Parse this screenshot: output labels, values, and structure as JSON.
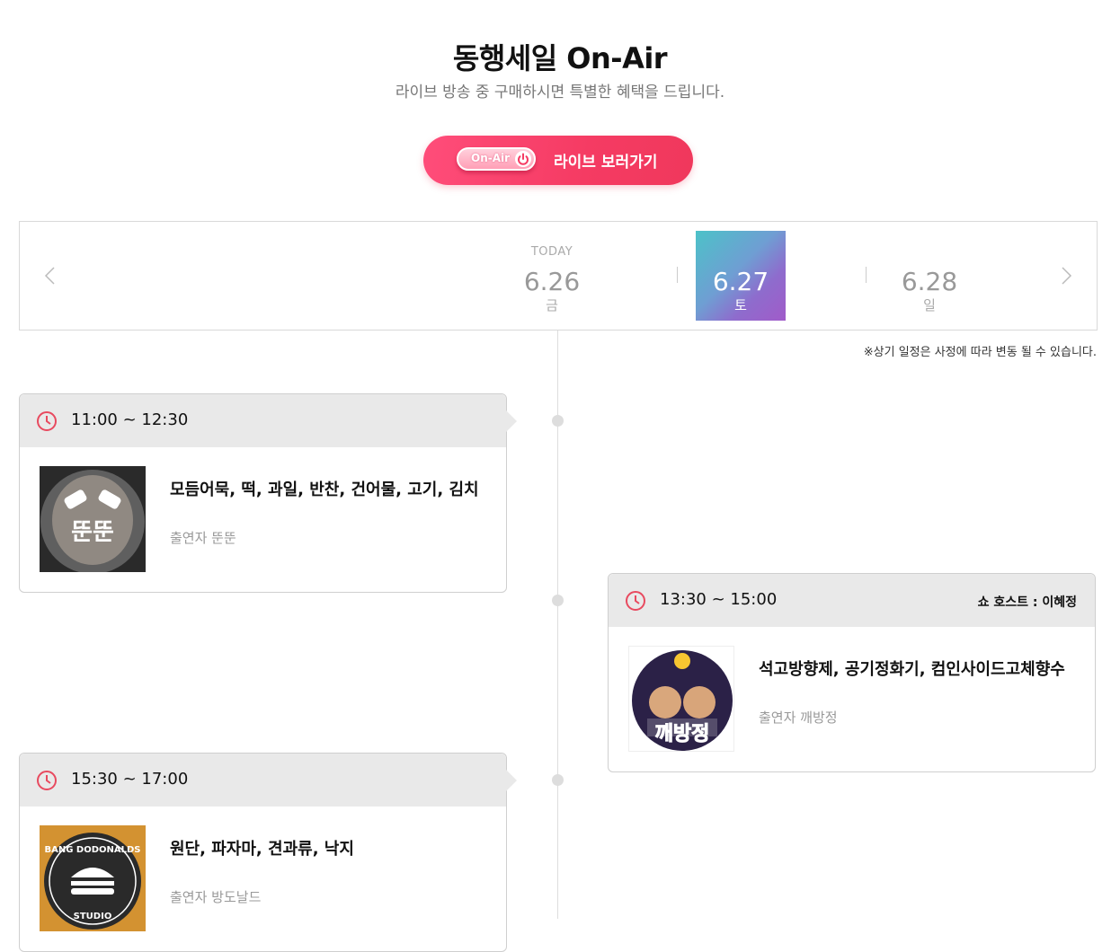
{
  "header": {
    "title": "동행세일 On-Air",
    "subtitle": "라이브 방송 중 구매하시면 특별한 혜택을 드립니다."
  },
  "live_button": {
    "badge": "On-Air",
    "label": "라이브 보러가기"
  },
  "date_nav": {
    "dates": [
      {
        "tag": "TODAY",
        "date": "6.26",
        "day": "금",
        "active": false
      },
      {
        "tag": "",
        "date": "6.27",
        "day": "토",
        "active": true
      },
      {
        "tag": "",
        "date": "6.28",
        "day": "일",
        "active": false
      }
    ]
  },
  "notice": "※상기 일정은 사정에 따라 변동 될 수 있습니다.",
  "schedule": [
    {
      "time": "11:00 ~ 12:30",
      "host": "",
      "products": "모듬어묵, 떡, 과일, 반찬, 건어물, 고기, 김치",
      "performer": "출연자 뚠뚠",
      "thumb_text": "뚠뚠"
    },
    {
      "time": "13:30 ~ 15:00",
      "host": "쇼 호스트 : 이혜정",
      "products": "석고방향제, 공기정화기, 컴인사이드고체향수",
      "performer": "출연자 깨방정",
      "thumb_text": "깨방정"
    },
    {
      "time": "15:30 ~ 17:00",
      "host": "",
      "products": "원단, 파자마, 견과류, 낙지",
      "performer": "출연자 방도날드",
      "thumb_text": "BANG DODONALDS",
      "thumb_sub": "STUDIO"
    }
  ],
  "colors": {
    "accent": "#f53b63",
    "clock": "#e84a5f",
    "active_date_gradient": [
      "#4cc2c8",
      "#a15bc9"
    ]
  }
}
